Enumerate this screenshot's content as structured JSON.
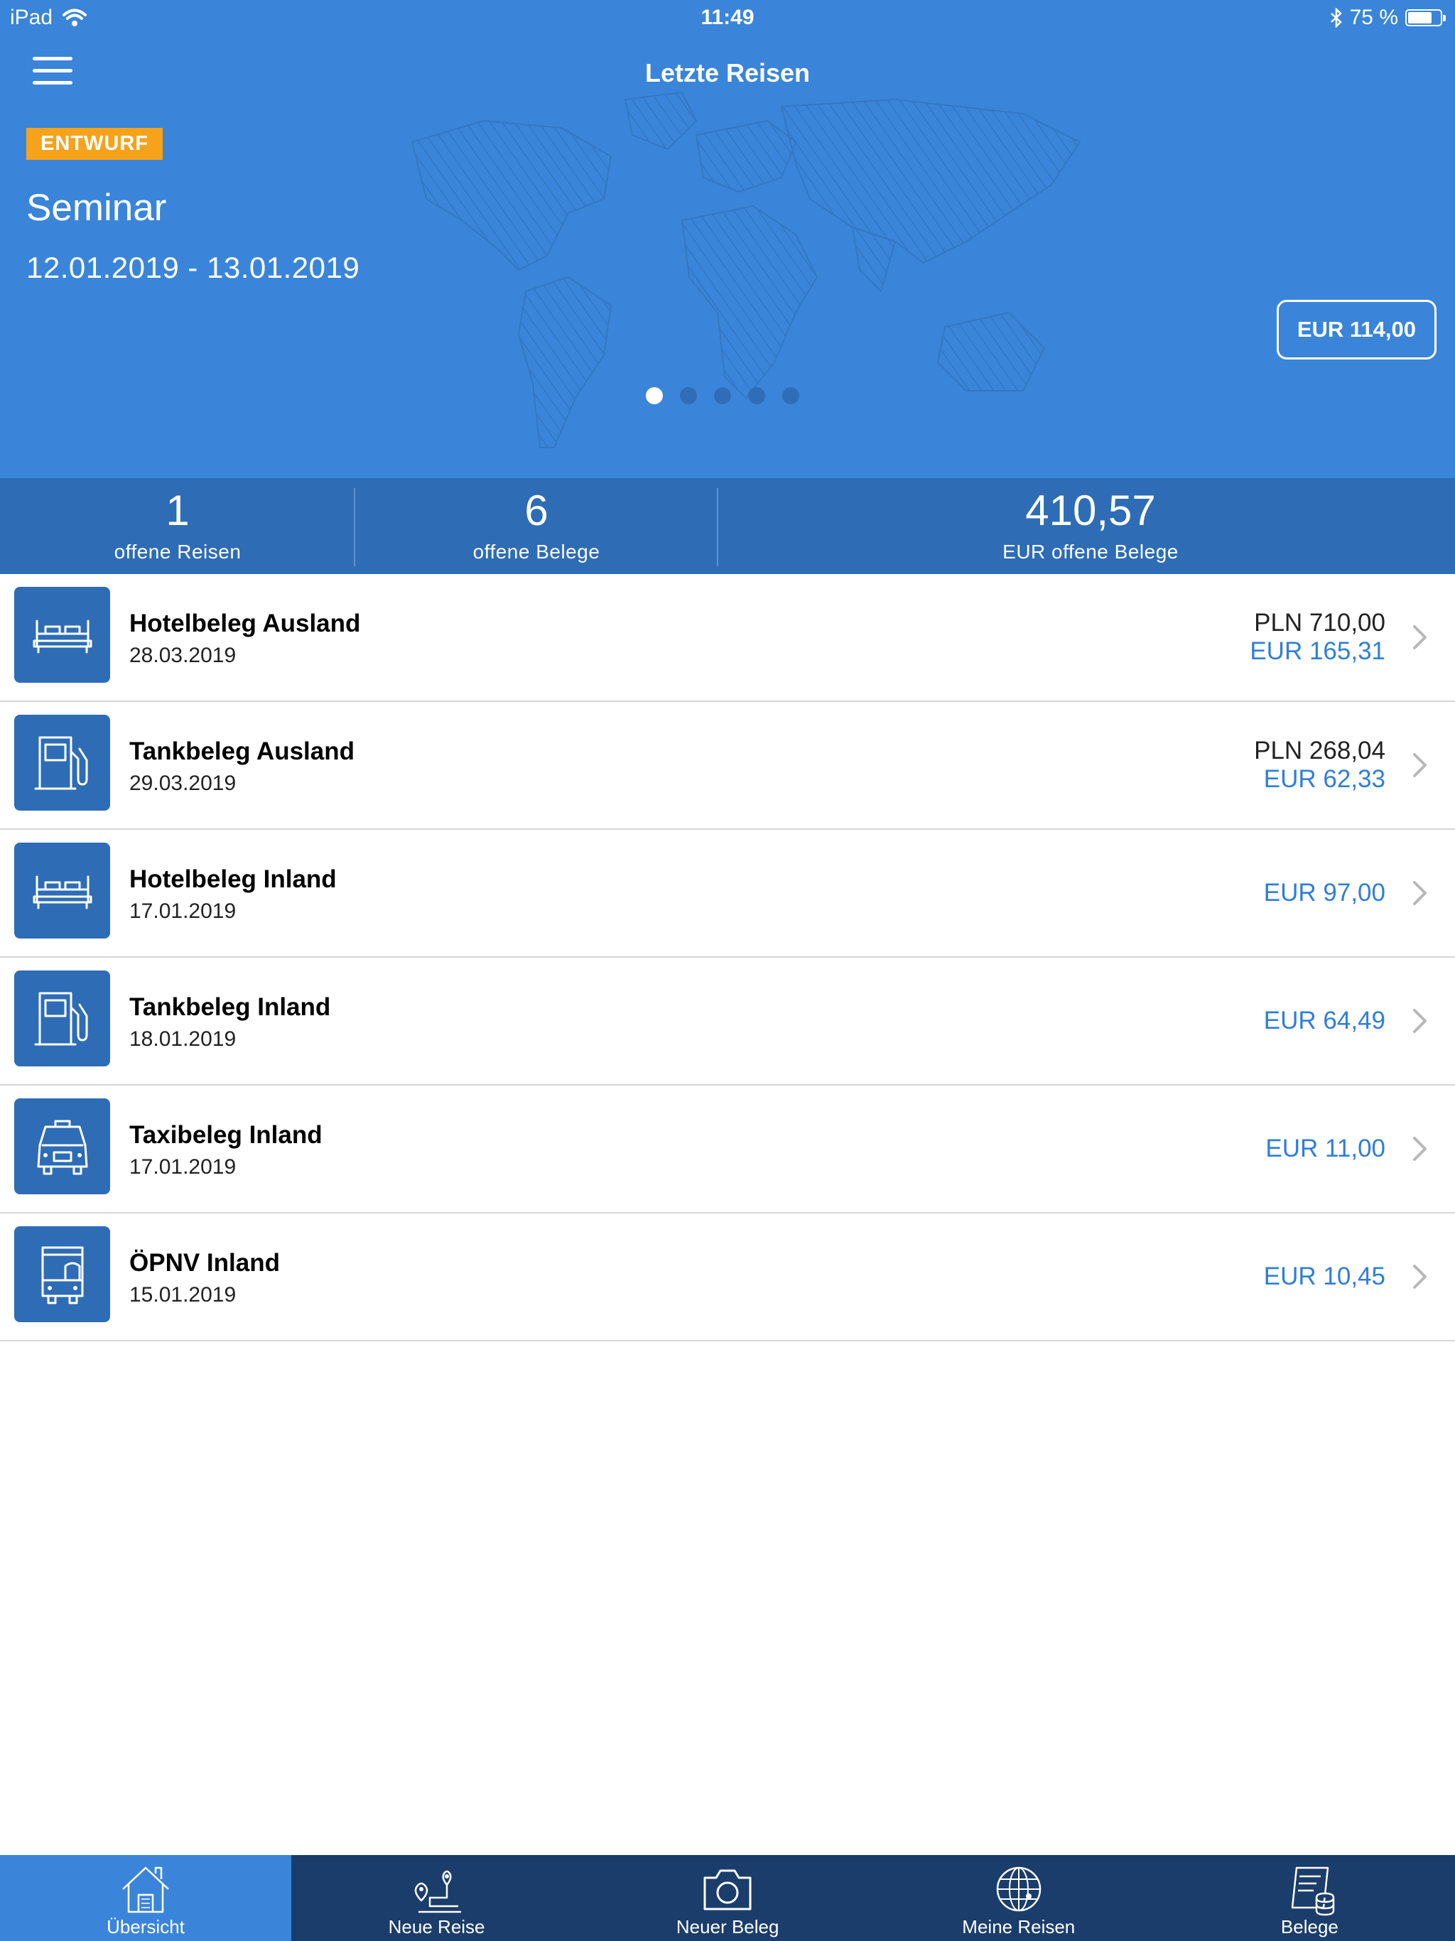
{
  "status_bar": {
    "device": "iPad",
    "time": "11:49",
    "battery": "75 %",
    "battery_level": 0.75
  },
  "header": {
    "title": "Letzte Reisen",
    "badge": "ENTWURF",
    "trip_name": "Seminar",
    "trip_dates": "12.01.2019  - 13.01.2019",
    "trip_amount": "EUR 114,00",
    "pager": {
      "count": 5,
      "active_index": 0
    }
  },
  "stats": [
    {
      "value": "1",
      "label": "offene Reisen"
    },
    {
      "value": "6",
      "label": "offene Belege"
    },
    {
      "value": "410,57",
      "label": "EUR offene Belege"
    }
  ],
  "receipts": [
    {
      "title": "Hotelbeleg Ausland",
      "date": "28.03.2019",
      "original_amount": "PLN 710,00",
      "eur_amount": "EUR 165,31",
      "icon": "bed-icon"
    },
    {
      "title": "Tankbeleg Ausland",
      "date": "29.03.2019",
      "original_amount": "PLN 268,04",
      "eur_amount": "EUR 62,33",
      "icon": "fuel-pump-icon"
    },
    {
      "title": "Hotelbeleg Inland",
      "date": "17.01.2019",
      "original_amount": "",
      "eur_amount": "EUR 97,00",
      "icon": "bed-icon"
    },
    {
      "title": "Tankbeleg Inland",
      "date": "18.01.2019",
      "original_amount": "",
      "eur_amount": "EUR 64,49",
      "icon": "fuel-pump-icon"
    },
    {
      "title": "Taxibeleg Inland",
      "date": "17.01.2019",
      "original_amount": "",
      "eur_amount": "EUR 11,00",
      "icon": "taxi-icon"
    },
    {
      "title": "ÖPNV Inland",
      "date": "15.01.2019",
      "original_amount": "",
      "eur_amount": "EUR 10,45",
      "icon": "bus-icon"
    }
  ],
  "tabbar": [
    {
      "label": "Übersicht",
      "icon": "house-icon",
      "active": true
    },
    {
      "label": "Neue Reise",
      "icon": "route-pin-icon",
      "active": false
    },
    {
      "label": "Neuer Beleg",
      "icon": "camera-icon",
      "active": false
    },
    {
      "label": "Meine Reisen",
      "icon": "globe-icon",
      "active": false
    },
    {
      "label": "Belege",
      "icon": "receipt-coins-icon",
      "active": false
    }
  ],
  "colors": {
    "header_blue": "#3a85d9",
    "stats_blue": "#2e6cb5",
    "tabbar_navy": "#1b3d6b",
    "badge_orange": "#f7a21b",
    "eur_blue": "#2f7ed8"
  }
}
